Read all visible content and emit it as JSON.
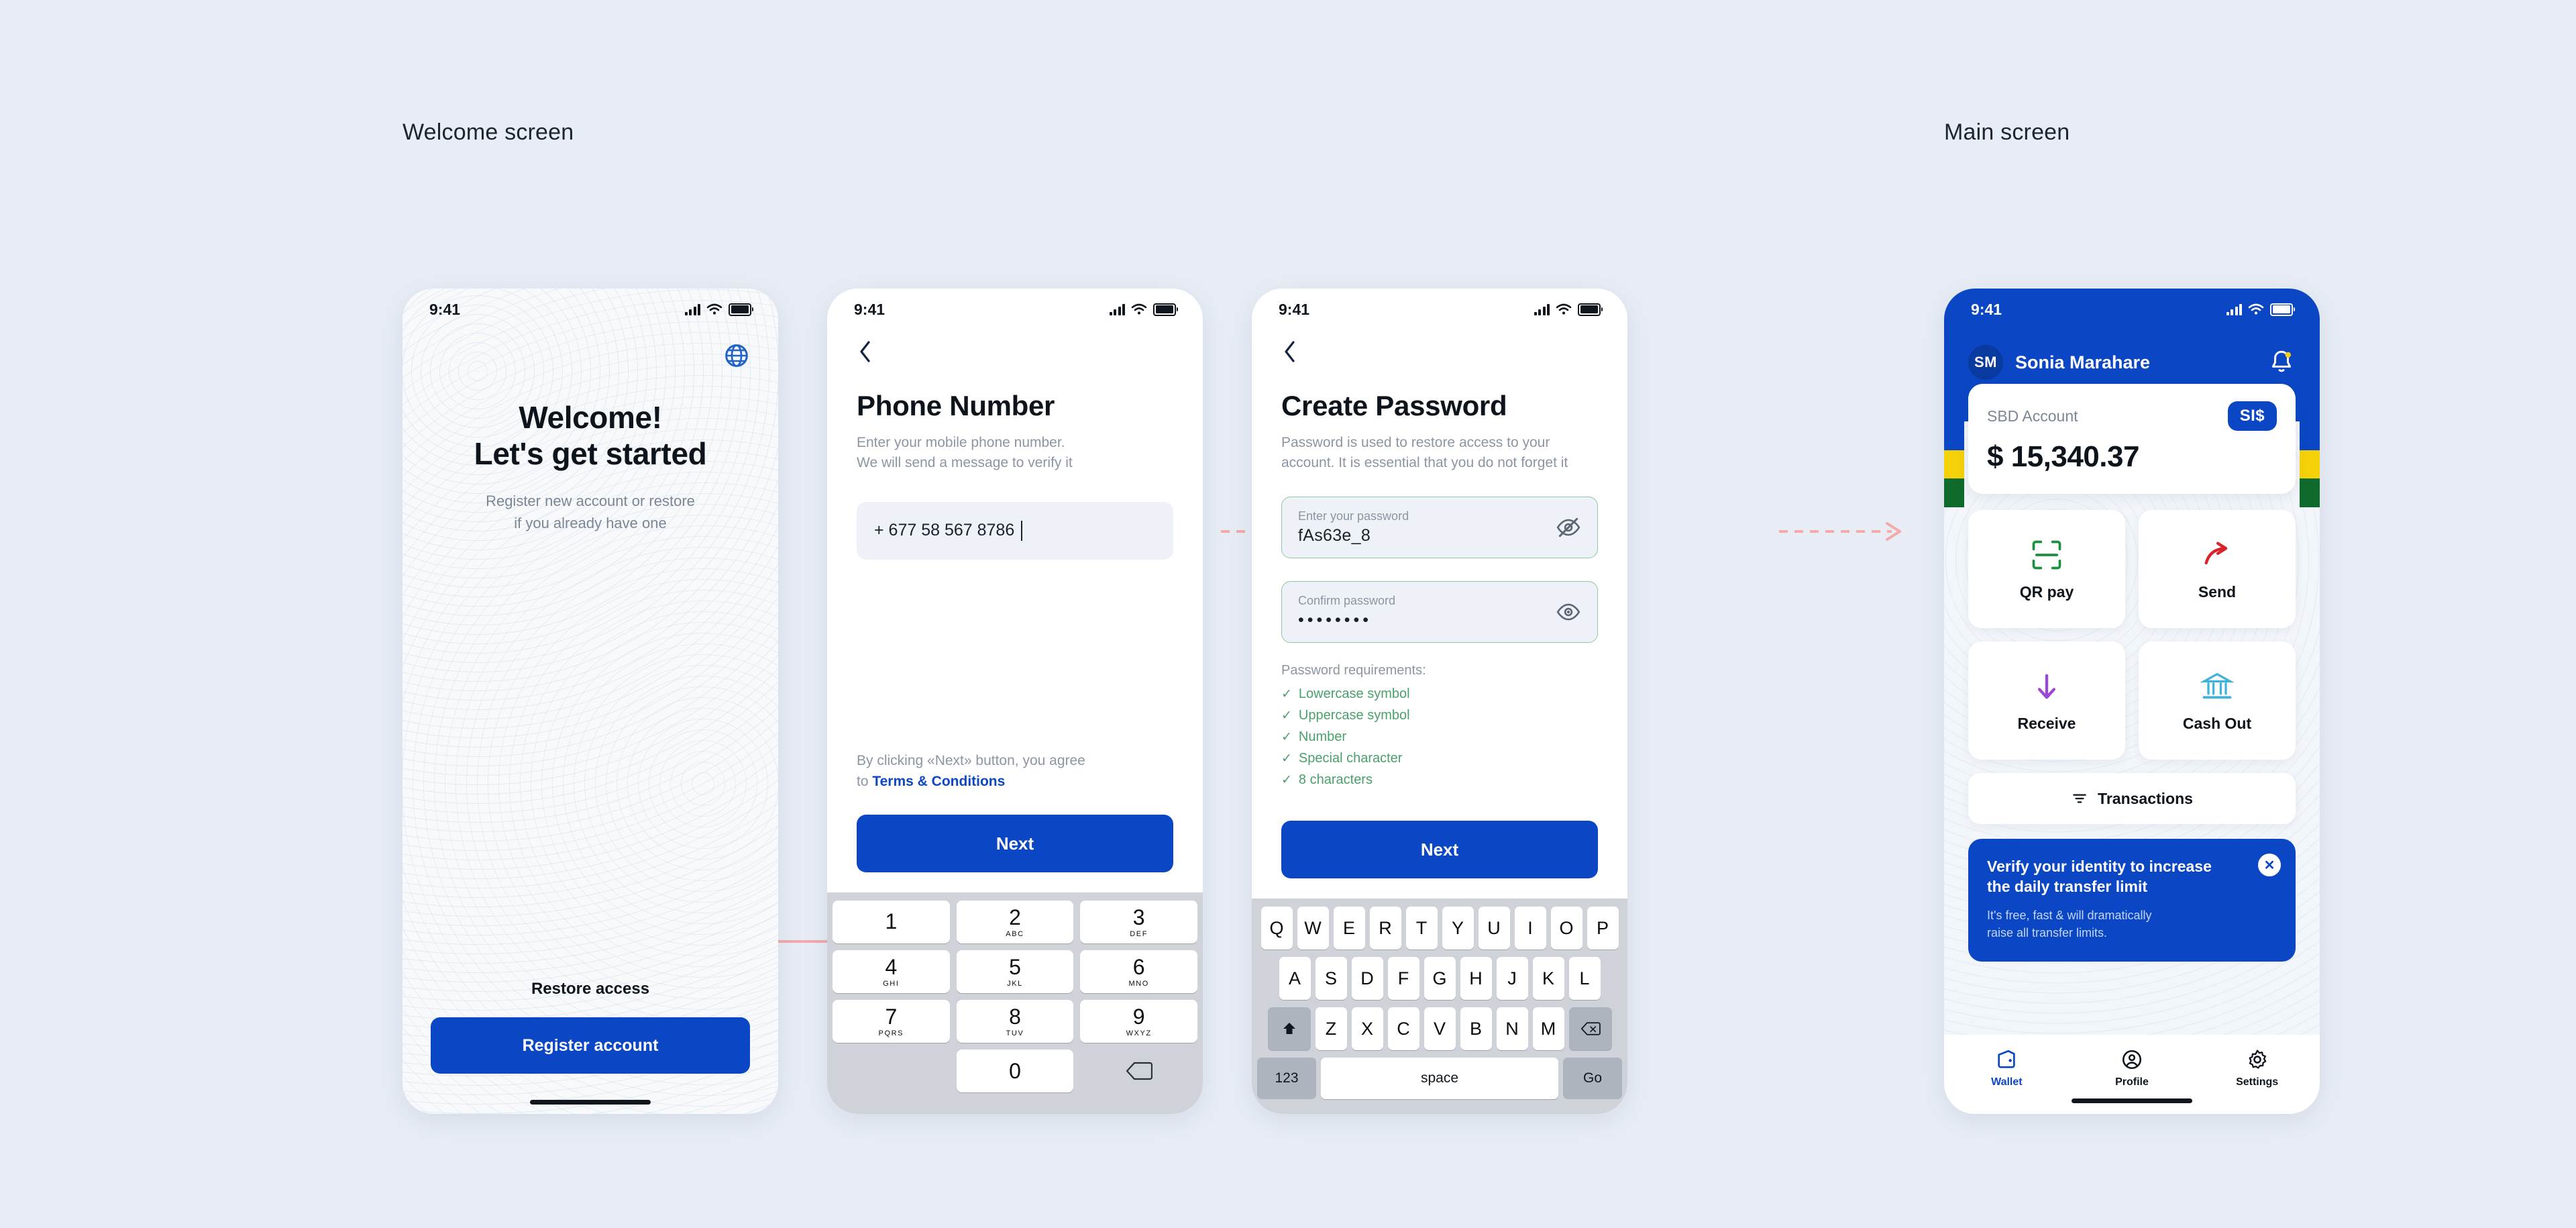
{
  "labels": {
    "welcome_section": "Welcome screen",
    "main_section": "Main screen"
  },
  "colors": {
    "brand_blue": "#0b47c4",
    "page_bg": "#e8edf5",
    "connector_pink": "#f0a8a8",
    "success_green": "#4aa06a",
    "flag_yellow": "#f5d10a",
    "flag_green": "#0f6a2b"
  },
  "status_bar": {
    "time": "9:41"
  },
  "screen1": {
    "title_line1": "Welcome!",
    "title_line2": "Let's get started",
    "subtitle_line1": "Register new account or restore",
    "subtitle_line2": "if you already have one",
    "restore_link": "Restore access",
    "register_button": "Register account",
    "language_icon": "globe-icon"
  },
  "screen2": {
    "back_icon": "chevron-left-icon",
    "title": "Phone Number",
    "lead_line1": "Enter your mobile phone number.",
    "lead_line2": "We will send a message to verify it",
    "phone_value": "+ 677 58 567 8786",
    "phone_placeholder": "+ 677 58 567 8786",
    "terms_line1": "By clicking «Next» button, you agree",
    "terms_prefix": "to ",
    "terms_link": "Terms & Conditions",
    "next_button": "Next",
    "keypad": [
      {
        "digit": "1",
        "letters": ""
      },
      {
        "digit": "2",
        "letters": "ABC"
      },
      {
        "digit": "3",
        "letters": "DEF"
      },
      {
        "digit": "4",
        "letters": "GHI"
      },
      {
        "digit": "5",
        "letters": "JKL"
      },
      {
        "digit": "6",
        "letters": "MNO"
      },
      {
        "digit": "7",
        "letters": "PQRS"
      },
      {
        "digit": "8",
        "letters": "TUV"
      },
      {
        "digit": "9",
        "letters": "WXYZ"
      },
      {
        "digit": "0",
        "letters": ""
      }
    ]
  },
  "screen3": {
    "back_icon": "chevron-left-icon",
    "title": "Create Password",
    "lead_line1": "Password is used to restore access to your",
    "lead_line2": "account. It is essential that you do not forget it",
    "password_label": "Enter your password",
    "password_value": "fAs63e_8",
    "confirm_label": "Confirm password",
    "confirm_value": "••••••••",
    "requirements_title": "Password requirements:",
    "requirements": [
      "Lowercase symbol",
      "Uppercase symbol",
      "Number",
      "Special character",
      "8 characters"
    ],
    "next_button": "Next",
    "keyboard": {
      "row1": [
        "Q",
        "W",
        "E",
        "R",
        "T",
        "Y",
        "U",
        "I",
        "O",
        "P"
      ],
      "row2": [
        "A",
        "S",
        "D",
        "F",
        "G",
        "H",
        "J",
        "K",
        "L"
      ],
      "row3": [
        "Z",
        "X",
        "C",
        "V",
        "B",
        "N",
        "M"
      ],
      "shift_icon": "shift-icon",
      "backspace_icon": "backspace-icon",
      "numbers_key": "123",
      "space_key": "space",
      "go_key": "Go"
    }
  },
  "screen4": {
    "avatar_initials": "SM",
    "user_name": "Sonia Marahare",
    "notification_icon": "bell-icon",
    "account_label": "SBD Account",
    "currency_badge": "SI$",
    "balance": "$ 15,340.37",
    "actions": [
      {
        "label": "QR pay",
        "icon": "qr-scan-icon"
      },
      {
        "label": "Send",
        "icon": "send-arrow-icon"
      },
      {
        "label": "Receive",
        "icon": "receive-arrow-icon"
      },
      {
        "label": "Cash Out",
        "icon": "bank-icon"
      }
    ],
    "transactions_label": "Transactions",
    "transactions_icon": "filter-icon",
    "promo": {
      "title_line1": "Verify your identity to increase",
      "title_line2": "the daily transfer limit",
      "sub_line1": "It's free, fast & will dramatically",
      "sub_line2": "raise all transfer limits.",
      "close_icon": "close-icon"
    },
    "tabs": [
      {
        "label": "Wallet",
        "icon": "wallet-icon",
        "active": true
      },
      {
        "label": "Profile",
        "icon": "profile-icon",
        "active": false
      },
      {
        "label": "Settings",
        "icon": "gear-icon",
        "active": false
      }
    ]
  },
  "connectors": [
    {
      "from": "register-account-button",
      "to": "phone-number-screen",
      "style": "solid-elbow"
    },
    {
      "from": "phone-number-screen",
      "to": "create-password-screen",
      "style": "dashed-arrow"
    },
    {
      "from": "create-password-screen",
      "to": "main-screen",
      "style": "dashed-arrow"
    }
  ]
}
